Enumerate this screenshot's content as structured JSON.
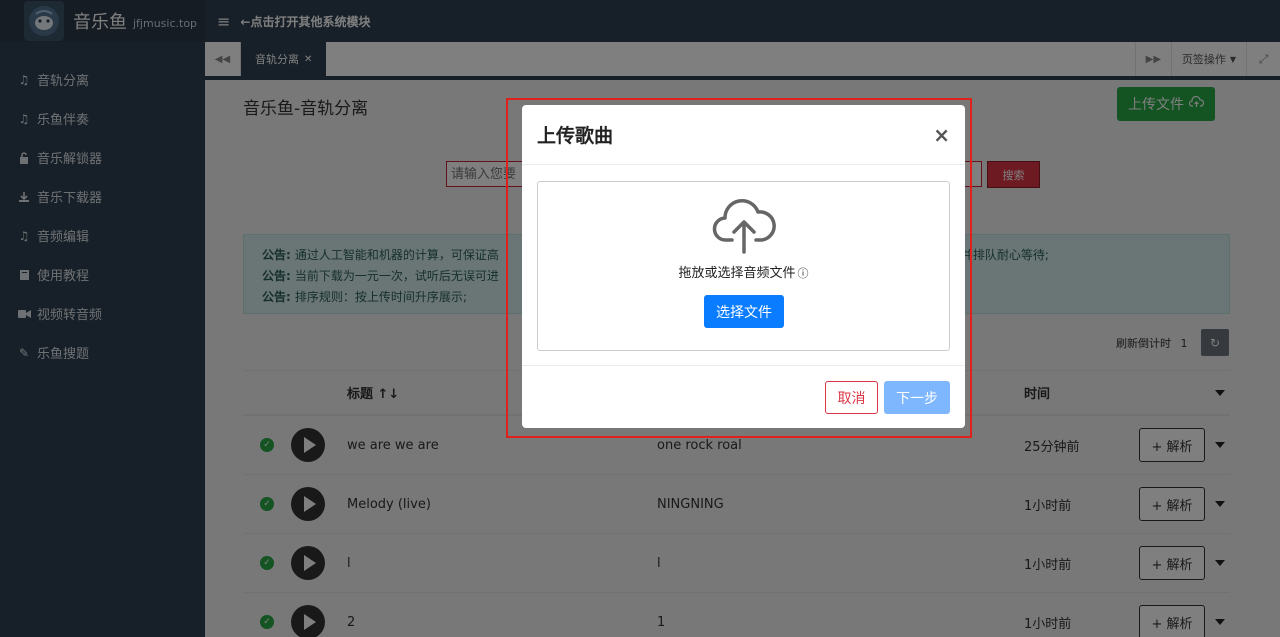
{
  "brand": {
    "name": "音乐鱼",
    "domain": "jfjmusic.top",
    "logo_icon": "fish-logo"
  },
  "topbar": {
    "menu_icon": "hamburger-icon",
    "hint": "←点击打开其他系统模块"
  },
  "sidebar": {
    "items": [
      {
        "label": "音轨分离",
        "icon": "music-note-icon"
      },
      {
        "label": "乐鱼伴奏",
        "icon": "music-note-icon"
      },
      {
        "label": "音乐解锁器",
        "icon": "unlock-icon"
      },
      {
        "label": "音乐下载器",
        "icon": "download-icon"
      },
      {
        "label": "音频编辑",
        "icon": "music-note-icon"
      },
      {
        "label": "使用教程",
        "icon": "book-icon"
      },
      {
        "label": "视频转音频",
        "icon": "video-camera-icon"
      },
      {
        "label": "乐鱼搜题",
        "icon": "pencil-icon"
      }
    ]
  },
  "tabs": {
    "active": "音轨分离",
    "operations": "页签操作"
  },
  "main": {
    "title": "音乐鱼-音轨分离",
    "upload_button": "上传文件",
    "search": {
      "placeholder": "请输入您要",
      "button": "搜索"
    },
    "notices": [
      {
        "label": "公告:",
        "text": "通过人工智能和机器的计算，可保证高",
        "tail": "解析并排队耐心等待;"
      },
      {
        "label": "公告:",
        "text": "当前下载为一元一次，试听后无误可进",
        "tail": ""
      },
      {
        "label": "公告:",
        "text": "排序规则：按上传时间升序展示;",
        "tail": ""
      }
    ],
    "refresh": {
      "label": "刷新倒计时",
      "count": "1"
    },
    "table": {
      "headers": {
        "title": "标题 ↑↓",
        "time": "时间"
      },
      "rows": [
        {
          "title": "we are we are",
          "artist": "one rock roal",
          "time": "25分钟前",
          "action": "+ 解析"
        },
        {
          "title": "Melody (live)",
          "artist": "NINGNING",
          "time": "1小时前",
          "action": "+ 解析"
        },
        {
          "title": "l",
          "artist": "l",
          "time": "1小时前",
          "action": "+ 解析"
        },
        {
          "title": "2",
          "artist": "1",
          "time": "1小时前",
          "action": "+ 解析"
        }
      ]
    }
  },
  "modal": {
    "title": "上传歌曲",
    "close": "×",
    "drop_text": "拖放或选择音频文件",
    "choose_button": "选择文件",
    "cancel_button": "取消",
    "next_button": "下一步"
  },
  "colors": {
    "sidebar_bg": "#2f4050",
    "upload_green": "#28a745",
    "search_red": "#dc3545",
    "primary_blue": "#0a7cff",
    "highlight_red": "#e0211b"
  }
}
